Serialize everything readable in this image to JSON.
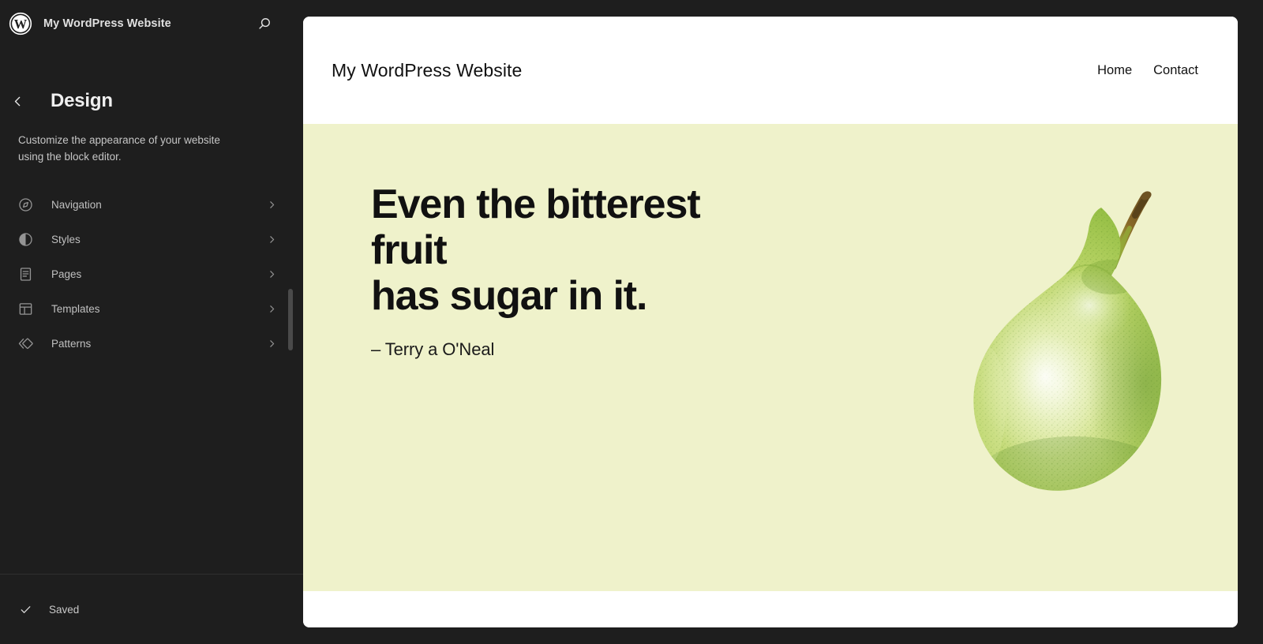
{
  "sidebar": {
    "logo_icon": "wordpress-logo-icon",
    "site_name": "My WordPress Website",
    "search_icon": "search-icon",
    "back_icon": "chevron-left-icon",
    "title": "Design",
    "description": "Customize the appearance of your website using the block editor.",
    "nav_items": [
      {
        "label": "Navigation",
        "icon": "navigation-compass-icon",
        "chevron": "chevron-right-icon"
      },
      {
        "label": "Styles",
        "icon": "styles-contrast-icon",
        "chevron": "chevron-right-icon"
      },
      {
        "label": "Pages",
        "icon": "pages-document-icon",
        "chevron": "chevron-right-icon"
      },
      {
        "label": "Templates",
        "icon": "templates-layout-icon",
        "chevron": "chevron-right-icon"
      },
      {
        "label": "Patterns",
        "icon": "patterns-diamonds-icon",
        "chevron": "chevron-right-icon"
      }
    ],
    "footer": {
      "status_icon": "check-icon",
      "status_label": "Saved"
    }
  },
  "preview": {
    "site_title": "My WordPress Website",
    "nav_links": [
      {
        "label": "Home"
      },
      {
        "label": "Contact"
      }
    ],
    "hero": {
      "quote_line1": "Even the bitterest fruit",
      "quote_line2": "has sugar in it.",
      "attribution": "– Terry a O'Neal",
      "image_icon": "pear-illustration-icon",
      "background_color": "#eff2cb"
    }
  },
  "colors": {
    "sidebar_bg": "#1e1e1e",
    "canvas_bg": "#1e1e1e",
    "hero_bg": "#eff2cb",
    "text_primary": "#f0f0f0",
    "text_secondary": "#c0c0c0",
    "pear_green": "#8cb83f"
  }
}
